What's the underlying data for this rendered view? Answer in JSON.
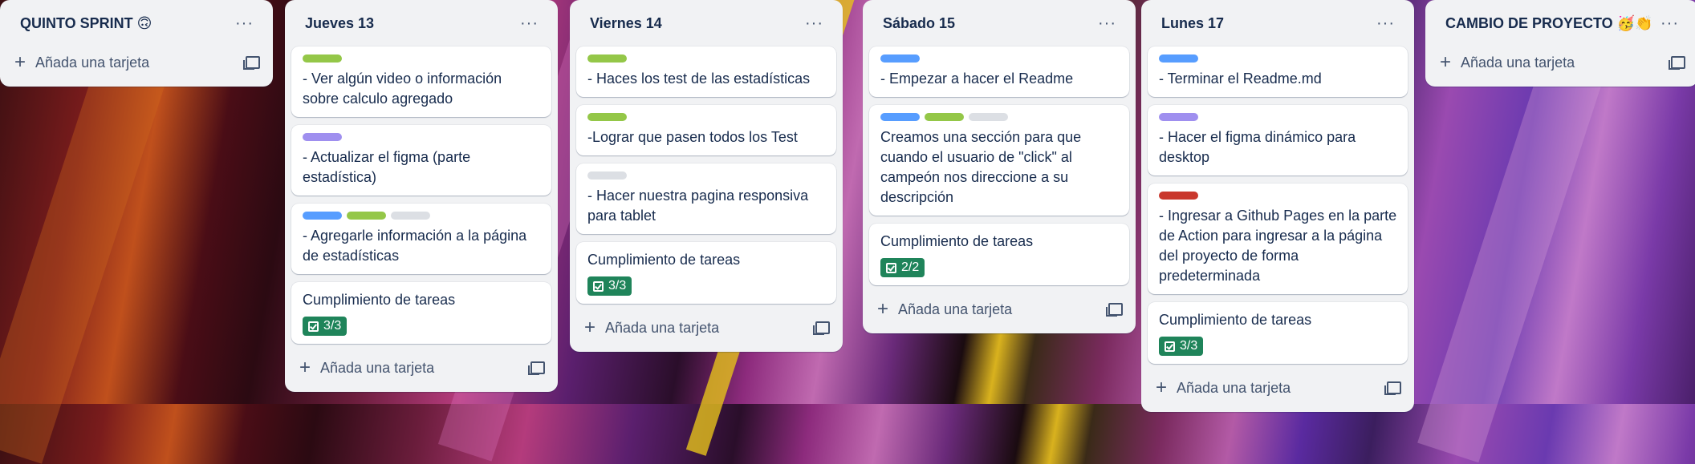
{
  "colors": {
    "label_green": "#94c748",
    "label_purple": "#9f8fef",
    "label_blue": "#579dff",
    "label_grey": "#dcdfe4",
    "label_red": "#c9372c",
    "badge_green": "#1f845a"
  },
  "common": {
    "add_card": "Añada una tarjeta",
    "menu": "···"
  },
  "lists": [
    {
      "title": "QUINTO SPRINT 🙃",
      "cards": []
    },
    {
      "title": "Jueves 13",
      "cards": [
        {
          "labels": [
            "green"
          ],
          "text": "- Ver algún video o información sobre calculo agregado"
        },
        {
          "labels": [
            "purple"
          ],
          "text": "- Actualizar el figma (parte estadística)"
        },
        {
          "labels": [
            "blue",
            "green",
            "grey"
          ],
          "text": "- Agregarle información a la página de estadísticas"
        },
        {
          "labels": [],
          "text": "Cumplimiento de tareas",
          "badge": "3/3"
        }
      ]
    },
    {
      "title": "Viernes 14",
      "cards": [
        {
          "labels": [
            "green"
          ],
          "text": "- Haces los test de las estadísticas"
        },
        {
          "labels": [
            "green"
          ],
          "text": "-Lograr que pasen todos los Test"
        },
        {
          "labels": [
            "grey"
          ],
          "text": "- Hacer nuestra pagina responsiva para tablet"
        },
        {
          "labels": [],
          "text": "Cumplimiento de tareas",
          "badge": "3/3"
        }
      ]
    },
    {
      "title": "Sábado 15",
      "cards": [
        {
          "labels": [
            "blue"
          ],
          "text": "- Empezar a hacer el Readme"
        },
        {
          "labels": [
            "blue",
            "green",
            "grey"
          ],
          "text": "Creamos una sección para que cuando el usuario de \"click\" al campeón nos direccione a su descripción"
        },
        {
          "labels": [],
          "text": "Cumplimiento de tareas",
          "badge": "2/2"
        }
      ]
    },
    {
      "title": "Lunes 17",
      "cards": [
        {
          "labels": [
            "blue"
          ],
          "text": "- Terminar el Readme.md"
        },
        {
          "labels": [
            "purple"
          ],
          "text": "- Hacer el figma dinámico para desktop"
        },
        {
          "labels": [
            "red"
          ],
          "text": "- Ingresar a Github Pages en la parte de Action para ingresar a la página del proyecto de forma predeterminada"
        },
        {
          "labels": [],
          "text": "Cumplimiento de tareas",
          "badge": "3/3"
        }
      ]
    },
    {
      "title": "CAMBIO DE PROYECTO 🥳👏",
      "cards": []
    }
  ]
}
